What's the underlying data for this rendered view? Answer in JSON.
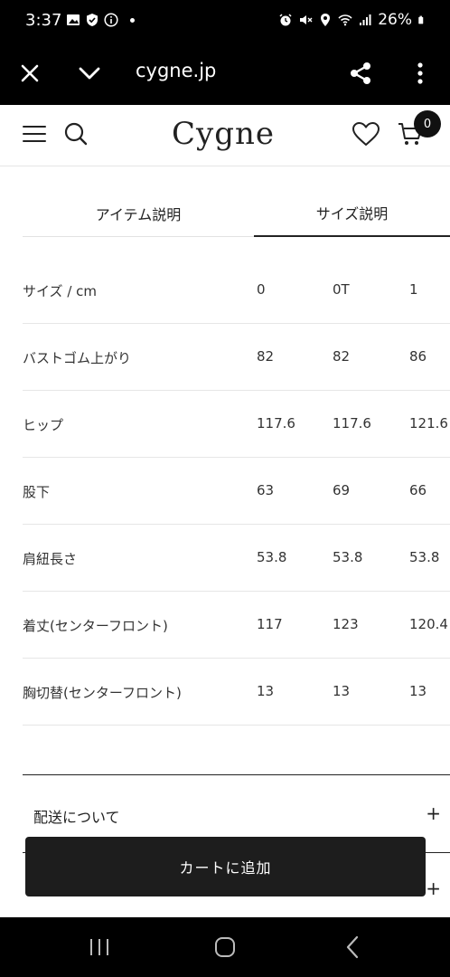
{
  "status_bar": {
    "time": "3:37",
    "battery": "26%"
  },
  "browser": {
    "url": "cygne.jp"
  },
  "site": {
    "logo": "Cygne",
    "cart_count": "0"
  },
  "tabs": [
    {
      "label": "アイテム説明",
      "active": false
    },
    {
      "label": "サイズ説明",
      "active": true
    }
  ],
  "size_table": {
    "rows": [
      {
        "label": "サイズ / cm",
        "values": [
          "0",
          "0T",
          "1"
        ]
      },
      {
        "label": "バストゴム上がり",
        "values": [
          "82",
          "82",
          "86"
        ]
      },
      {
        "label": "ヒップ",
        "values": [
          "117.6",
          "117.6",
          "121.6"
        ]
      },
      {
        "label": "股下",
        "values": [
          "63",
          "69",
          "66"
        ]
      },
      {
        "label": "肩紐長さ",
        "values": [
          "53.8",
          "53.8",
          "53.8"
        ]
      },
      {
        "label": "着丈(センターフロント)",
        "values": [
          "117",
          "123",
          "120.4"
        ]
      },
      {
        "label": "胸切替(センターフロント)",
        "values": [
          "13",
          "13",
          "13"
        ]
      }
    ]
  },
  "accordion": [
    {
      "label": "配送について",
      "icon": "+"
    },
    {
      "label": "",
      "icon": "+"
    }
  ],
  "add_to_cart": {
    "label": "カートに追加"
  }
}
